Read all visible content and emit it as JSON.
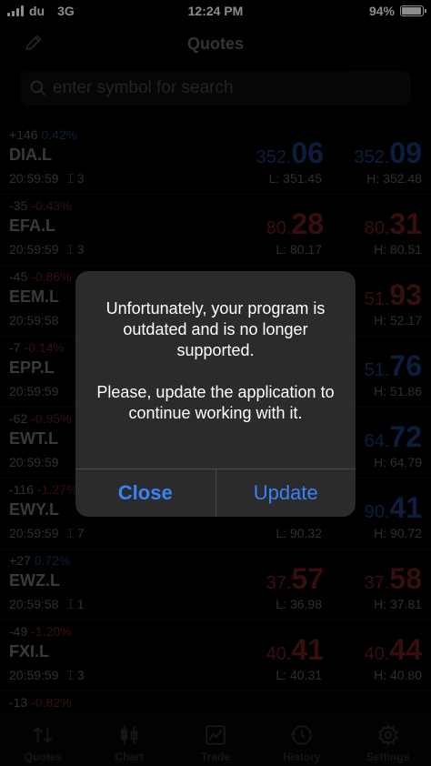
{
  "status_bar": {
    "carrier": "du",
    "network": "3G",
    "time": "12:24 PM",
    "battery": "94%",
    "battery_level": 0.94
  },
  "nav": {
    "title": "Quotes"
  },
  "search": {
    "placeholder": "enter symbol for search"
  },
  "quotes": [
    {
      "change": "+146",
      "pct": "0.42%",
      "dir": "up",
      "symbol": "DIA.L",
      "time": "20:59:59",
      "lots": "3",
      "bid_small": "352.",
      "bid_big": "06",
      "ask_small": "352.",
      "ask_big": "09",
      "price_color": "blue",
      "low": "L: 351.45",
      "high": "H: 352.48"
    },
    {
      "change": "-35",
      "pct": "-0.43%",
      "dir": "down",
      "symbol": "EFA.L",
      "time": "20:59:59",
      "lots": "3",
      "bid_small": "80.",
      "bid_big": "28",
      "ask_small": "80.",
      "ask_big": "31",
      "price_color": "red",
      "low": "L: 80.17",
      "high": "H: 80.51"
    },
    {
      "change": "-45",
      "pct": "-0.86%",
      "dir": "down",
      "symbol": "EEM.L",
      "time": "20:59:58",
      "lots": "",
      "bid_small": "",
      "bid_big": "",
      "ask_small": "51.",
      "ask_big": "93",
      "price_color": "red",
      "low": "",
      "high": "H: 52.17"
    },
    {
      "change": "-7",
      "pct": "-0.14%",
      "dir": "down",
      "symbol": "EPP.L",
      "time": "20:59:59",
      "lots": "",
      "bid_small": "",
      "bid_big": "",
      "ask_small": "51.",
      "ask_big": "76",
      "price_color": "blue",
      "low": "",
      "high": "H: 51.86"
    },
    {
      "change": "-62",
      "pct": "-0.95%",
      "dir": "down",
      "symbol": "EWT.L",
      "time": "20:59:59",
      "lots": "",
      "bid_small": "",
      "bid_big": "",
      "ask_small": "64.",
      "ask_big": "72",
      "price_color": "blue",
      "low": "",
      "high": "H: 64.79"
    },
    {
      "change": "-116",
      "pct": "-1.27%",
      "dir": "down",
      "symbol": "EWY.L",
      "time": "20:59:59",
      "lots": "7",
      "bid_small": "",
      "bid_big": "",
      "ask_small": "90.",
      "ask_big": "41",
      "price_color": "blue",
      "low": "L: 90.32",
      "high": "H: 90.72"
    },
    {
      "change": "+27",
      "pct": "0.72%",
      "dir": "up",
      "symbol": "EWZ.L",
      "time": "20:59:58",
      "lots": "1",
      "bid_small": "37.",
      "bid_big": "57",
      "ask_small": "37.",
      "ask_big": "58",
      "price_color": "red",
      "low": "L: 36.98",
      "high": "H: 37.81"
    },
    {
      "change": "-49",
      "pct": "-1.20%",
      "dir": "down",
      "symbol": "FXI.L",
      "time": "20:59:59",
      "lots": "3",
      "bid_small": "40.",
      "bid_big": "41",
      "ask_small": "40.",
      "ask_big": "44",
      "price_color": "red",
      "low": "L: 40.31",
      "high": "H: 40.80"
    },
    {
      "change": "-13",
      "pct": "-0.82%",
      "dir": "down",
      "symbol": "",
      "time": "",
      "lots": "",
      "bid_small": "",
      "bid_big": "",
      "ask_small": "",
      "ask_big": "",
      "price_color": "red",
      "low": "",
      "high": ""
    }
  ],
  "alert": {
    "line1": "Unfortunately, your program is outdated and is no longer supported.",
    "line2": "Please, update the application to continue working with it.",
    "close_label": "Close",
    "update_label": "Update"
  },
  "tabbar": {
    "items": [
      {
        "label": "Quotes",
        "icon": "arrows-updown-icon"
      },
      {
        "label": "Chart",
        "icon": "candlestick-icon"
      },
      {
        "label": "Trade",
        "icon": "trend-chart-icon"
      },
      {
        "label": "History",
        "icon": "clock-icon"
      },
      {
        "label": "Settings",
        "icon": "gear-icon"
      }
    ]
  },
  "colors": {
    "blue": "#3478f6",
    "red": "#e03a3a",
    "alert_bg": "#2c2c2e",
    "button_blue": "#3a82f7"
  }
}
